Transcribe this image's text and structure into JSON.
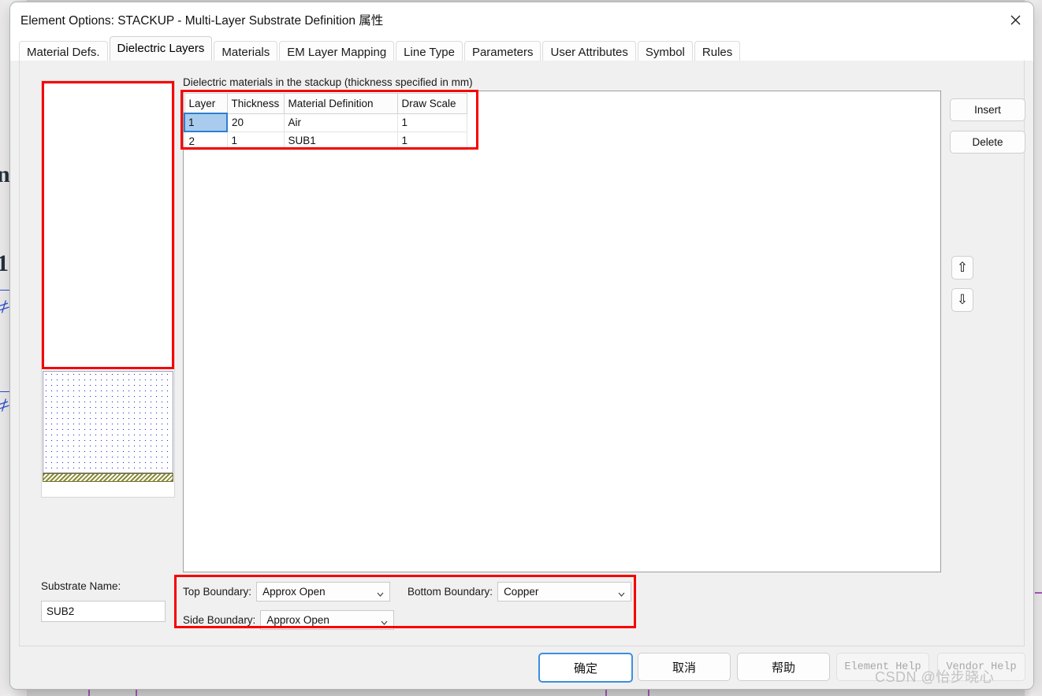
{
  "window": {
    "title": "Element Options: STACKUP - Multi-Layer Substrate Definition 属性",
    "close_icon": "close-icon"
  },
  "tabs": [
    {
      "label": "Material Defs.",
      "active": false
    },
    {
      "label": "Dielectric Layers",
      "active": true
    },
    {
      "label": "Materials",
      "active": false
    },
    {
      "label": "EM Layer Mapping",
      "active": false
    },
    {
      "label": "Line Type",
      "active": false
    },
    {
      "label": "Parameters",
      "active": false
    },
    {
      "label": "User Attributes",
      "active": false
    },
    {
      "label": "Symbol",
      "active": false
    },
    {
      "label": "Rules",
      "active": false
    }
  ],
  "grid": {
    "caption": "Dielectric materials in the stackup (thickness specified in mm)",
    "columns": [
      "Layer",
      "Thickness",
      "Material Definition",
      "Draw Scale"
    ],
    "rows": [
      {
        "layer": "1",
        "thickness": "20",
        "material": "Air",
        "draw_scale": "1",
        "selected": true
      },
      {
        "layer": "2",
        "thickness": "1",
        "material": "SUB1",
        "draw_scale": "1",
        "selected": false
      }
    ]
  },
  "side_buttons": {
    "insert": "Insert",
    "delete": "Delete",
    "move_up_icon": "arrow-up-icon",
    "move_down_icon": "arrow-down-icon",
    "move_up_glyph": "⇧",
    "move_down_glyph": "⇩"
  },
  "substrate": {
    "name_label": "Substrate Name:",
    "name_value": "SUB2"
  },
  "boundaries": {
    "top": {
      "label": "Top Boundary:",
      "value": "Approx Open"
    },
    "bottom": {
      "label": "Bottom Boundary:",
      "value": "Copper"
    },
    "side": {
      "label": "Side Boundary:",
      "value": "Approx Open"
    }
  },
  "footer": {
    "ok": "确定",
    "cancel": "取消",
    "help": "帮助",
    "element_help": "Element Help",
    "vendor_help": "Vendor Help"
  },
  "watermark": "CSDN @怡步晓心",
  "colors": {
    "highlight_red": "#f80000",
    "selection_blue": "#a9ccee",
    "primary_border": "#3b8fe0",
    "dielectric_dot": "#2f2fd0",
    "copper_hatch": "#8b8b36"
  }
}
